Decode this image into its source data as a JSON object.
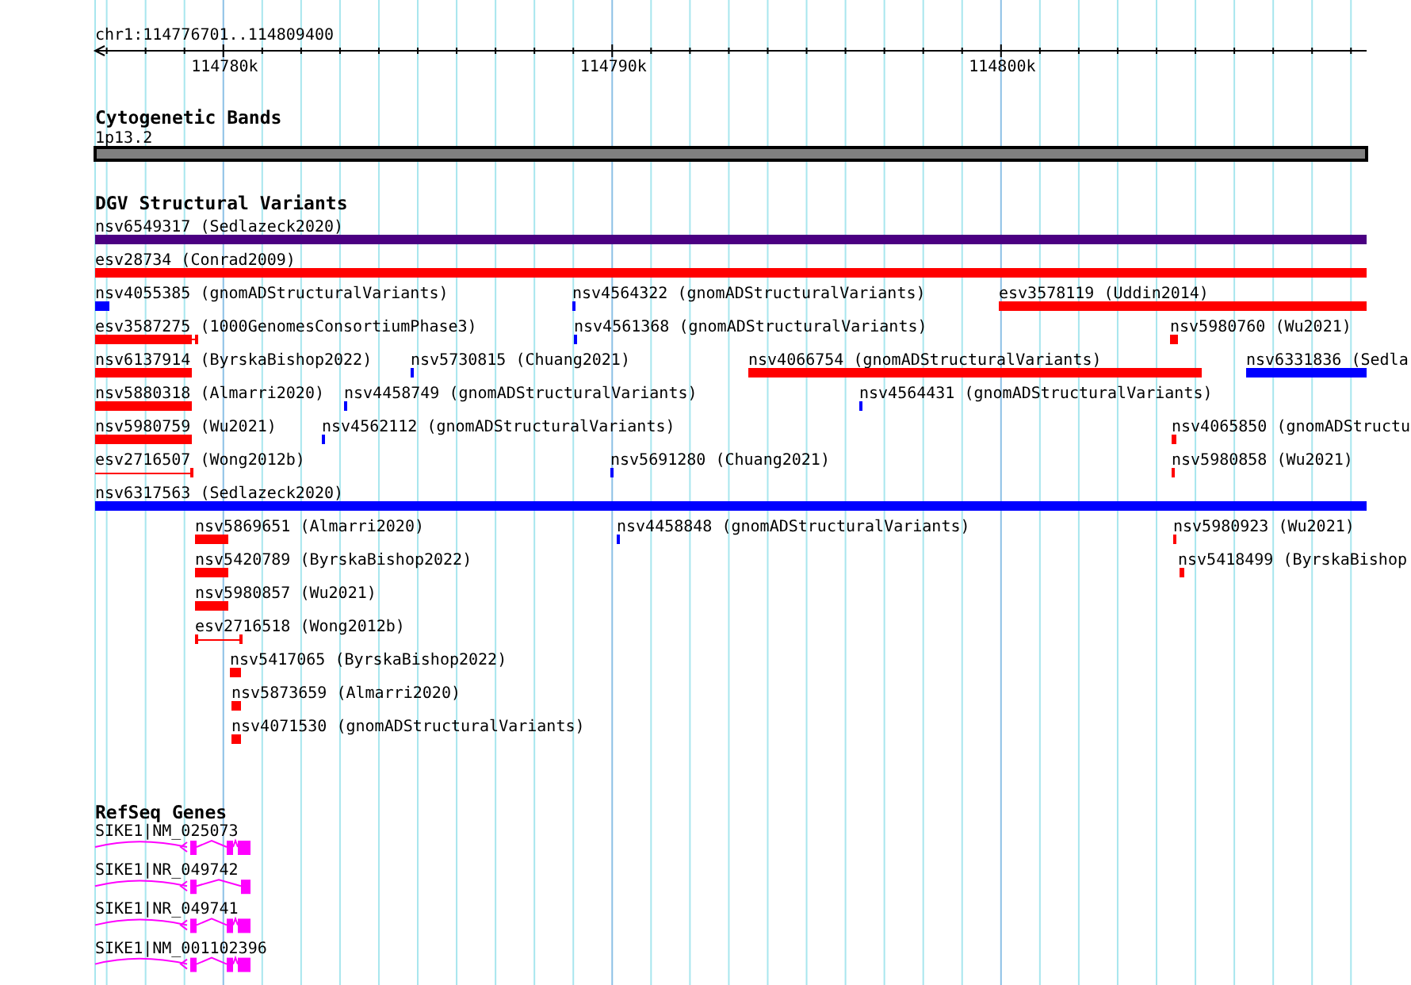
{
  "ruler": {
    "range": "chr1:114776701..114809400",
    "tick_labels": [
      "114780k",
      "114790k",
      "114800k"
    ]
  },
  "cytogenetic_bands": {
    "title": "Cytogenetic Bands",
    "band": {
      "label": "1p13.2"
    }
  },
  "dgv": {
    "title": "DGV Structural Variants",
    "rows": [
      {
        "features": [
          {
            "label": "nsv6549317 (Sedlazeck2020)",
            "color": "#4b0082",
            "kind": "bar"
          }
        ]
      },
      {
        "features": [
          {
            "label": "esv28734 (Conrad2009)",
            "color": "#ff0000",
            "kind": "bar"
          }
        ]
      },
      {
        "features": [
          {
            "label": "nsv4055385 (gnomADStructuralVariants)",
            "color": "#0000ff",
            "kind": "bar"
          },
          {
            "label": "nsv4564322 (gnomADStructuralVariants)",
            "color": "#0000ff",
            "kind": "bar"
          },
          {
            "label": "esv3578119 (Uddin2014)",
            "color": "#ff0000",
            "kind": "bar"
          }
        ]
      },
      {
        "features": [
          {
            "label": "esv3587275 (1000GenomesConsortiumPhase3)",
            "color": "#ff0000",
            "kind": "bar"
          },
          {
            "label": "nsv4561368 (gnomADStructuralVariants)",
            "color": "#0000ff",
            "kind": "bar"
          },
          {
            "label": "nsv5980760 (Wu2021)",
            "color": "#ff0000",
            "kind": "bar"
          }
        ]
      },
      {
        "features": [
          {
            "label": "nsv6137914 (ByrskaBishop2022)",
            "color": "#ff0000",
            "kind": "bar"
          },
          {
            "label": "nsv5730815 (Chuang2021)",
            "color": "#0000ff",
            "kind": "bar"
          },
          {
            "label": "nsv4066754 (gnomADStructuralVariants)",
            "color": "#ff0000",
            "kind": "bar"
          },
          {
            "label": "nsv6331836 (Sedla",
            "color": "#0000ff",
            "kind": "bar"
          }
        ]
      },
      {
        "features": [
          {
            "label": "nsv5880318 (Almarri2020)",
            "color": "#ff0000",
            "kind": "bar"
          },
          {
            "label": "nsv4458749 (gnomADStructuralVariants)",
            "color": "#0000ff",
            "kind": "bar"
          },
          {
            "label": "nsv4564431 (gnomADStructuralVariants)",
            "color": "#0000ff",
            "kind": "bar"
          }
        ]
      },
      {
        "features": [
          {
            "label": "nsv5980759 (Wu2021)",
            "color": "#ff0000",
            "kind": "bar"
          },
          {
            "label": "nsv4562112 (gnomADStructuralVariants)",
            "color": "#0000ff",
            "kind": "bar"
          },
          {
            "label": "nsv4065850 (gnomADStructu",
            "color": "#ff0000",
            "kind": "bar"
          }
        ]
      },
      {
        "features": [
          {
            "label": "esv2716507 (Wong2012b)",
            "color": "#ff0000",
            "kind": "range"
          },
          {
            "label": "nsv5691280 (Chuang2021)",
            "color": "#0000ff",
            "kind": "bar"
          },
          {
            "label": "nsv5980858 (Wu2021)",
            "color": "#ff0000",
            "kind": "bar"
          }
        ]
      },
      {
        "features": [
          {
            "label": "nsv6317563 (Sedlazeck2020)",
            "color": "#0000ff",
            "kind": "bar"
          }
        ]
      },
      {
        "features": [
          {
            "label": "nsv5869651 (Almarri2020)",
            "color": "#ff0000",
            "kind": "bar"
          },
          {
            "label": "nsv4458848 (gnomADStructuralVariants)",
            "color": "#0000ff",
            "kind": "bar"
          },
          {
            "label": "nsv5980923 (Wu2021)",
            "color": "#ff0000",
            "kind": "bar"
          }
        ]
      },
      {
        "features": [
          {
            "label": "nsv5420789 (ByrskaBishop2022)",
            "color": "#ff0000",
            "kind": "bar"
          },
          {
            "label": "nsv5418499 (ByrskaBishop",
            "color": "#ff0000",
            "kind": "bar"
          }
        ]
      },
      {
        "features": [
          {
            "label": "nsv5980857 (Wu2021)",
            "color": "#ff0000",
            "kind": "bar"
          }
        ]
      },
      {
        "features": [
          {
            "label": "esv2716518 (Wong2012b)",
            "color": "#ff0000",
            "kind": "range"
          }
        ]
      },
      {
        "features": [
          {
            "label": "nsv5417065 (ByrskaBishop2022)",
            "color": "#ff0000",
            "kind": "bar"
          }
        ]
      },
      {
        "features": [
          {
            "label": "nsv5873659 (Almarri2020)",
            "color": "#ff0000",
            "kind": "bar"
          }
        ]
      },
      {
        "features": [
          {
            "label": "nsv4071530 (gnomADStructuralVariants)",
            "color": "#ff0000",
            "kind": "bar"
          }
        ]
      }
    ]
  },
  "refseq_genes": {
    "title": "RefSeq Genes",
    "genes": [
      {
        "label": "SIKE1|NM_025073"
      },
      {
        "label": "SIKE1|NR_049742"
      },
      {
        "label": "SIKE1|NR_049741"
      },
      {
        "label": "SIKE1|NM_001102396"
      }
    ]
  }
}
